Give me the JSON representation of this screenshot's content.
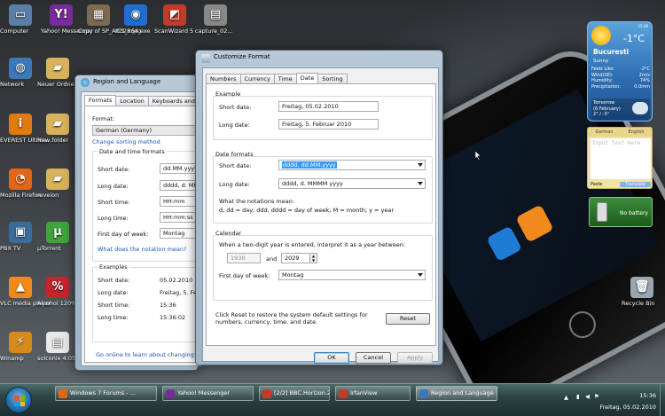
{
  "desktop": {
    "icons": [
      {
        "label": "Computer",
        "color": "#5a7ea6",
        "glyph": "▭"
      },
      {
        "label": "Yahoo! Messenger",
        "color": "#7a2aa0",
        "glyph": "Y!"
      },
      {
        "label": "Copy of SP_A0028.jpg",
        "color": "#7c6a52",
        "glyph": "▦"
      },
      {
        "label": "ICS_x64.exe",
        "color": "#1e6fd0",
        "glyph": "◉"
      },
      {
        "label": "ScanWizard 5",
        "color": "#c43a2a",
        "glyph": "◩"
      },
      {
        "label": "capture_02...",
        "color": "#888888",
        "glyph": "▤"
      },
      {
        "label": "Network",
        "color": "#3c78b8",
        "glyph": "◍"
      },
      {
        "label": "Neuer Ordner",
        "color": "#d9b35b",
        "glyph": "▰"
      },
      {
        "label": "EVEREST Ultima...",
        "color": "#e07b12",
        "glyph": "i"
      },
      {
        "label": "New folder",
        "color": "#d9b35b",
        "glyph": "▰"
      },
      {
        "label": "Mozilla Firefox",
        "color": "#e0661b",
        "glyph": "◔"
      },
      {
        "label": "reveion",
        "color": "#d9b35b",
        "glyph": "▰"
      },
      {
        "label": "PBX TV",
        "color": "#3a6c9a",
        "glyph": "▣"
      },
      {
        "label": "µTorrent",
        "color": "#3fa43a",
        "glyph": "µ"
      },
      {
        "label": "VLC media player",
        "color": "#f08a1c",
        "glyph": "▲"
      },
      {
        "label": "Alcohol 120%",
        "color": "#c3262a",
        "glyph": "%"
      },
      {
        "label": "Winamp",
        "color": "#d68a1a",
        "glyph": "⚡"
      },
      {
        "label": "solconix 4:05 12-01",
        "color": "#e8e8e8",
        "glyph": "▤"
      }
    ],
    "recycle_bin": "Recycle Bin"
  },
  "gadgets": {
    "weather": {
      "time": "15:36",
      "temperature": "-1°C",
      "city": "Bucuresti",
      "condition": "Sunny",
      "details": [
        {
          "k": "Feels Like:",
          "v": "-2°C"
        },
        {
          "k": "Wind(SE):",
          "v": "2m/s"
        },
        {
          "k": "Humidity:",
          "v": "74%"
        },
        {
          "k": "Precipitation:",
          "v": "0.0mm"
        }
      ],
      "tomorrow_label": "Tomorrow",
      "tomorrow_date": "(6 February)",
      "tomorrow_temps": "2° / -3°"
    },
    "translate": {
      "from": "German",
      "to": "English",
      "placeholder": "Input Text Here",
      "paste": "Paste",
      "button": "Translate"
    },
    "battery": {
      "status": "No battery"
    }
  },
  "region_window": {
    "title": "Region and Language",
    "tabs": [
      "Formats",
      "Location",
      "Keyboards and Langua"
    ],
    "format_label": "Format:",
    "format_value": "German (Germany)",
    "change_sorting": "Change sorting method",
    "date_time_header": "Date and time formats",
    "rows": [
      {
        "label": "Short date:",
        "value": "dd.MM.yyyy"
      },
      {
        "label": "Long date:",
        "value": "dddd, d. MMM"
      },
      {
        "label": "Short time:",
        "value": "HH:mm"
      },
      {
        "label": "Long time:",
        "value": "HH:mm:ss"
      },
      {
        "label": "First day of week:",
        "value": "Montag"
      }
    ],
    "notation_link": "What does the notation mean?",
    "examples_header": "Examples",
    "examples": [
      {
        "label": "Short date:",
        "value": "05.02.2010"
      },
      {
        "label": "Long date:",
        "value": "Freitag, 5. Febr"
      },
      {
        "label": "Short time:",
        "value": "15:36"
      },
      {
        "label": "Long time:",
        "value": "15:36:02"
      }
    ],
    "online_link": "Go online to learn about changing lan"
  },
  "customize_format": {
    "title": "Customize Format",
    "tabs": [
      "Numbers",
      "Currency",
      "Time",
      "Date",
      "Sorting"
    ],
    "active_tab": "Date",
    "example_header": "Example",
    "example_short_label": "Short date:",
    "example_short_value": "Freitag, 05.02.2010",
    "example_long_label": "Long date:",
    "example_long_value": "Freitag, 5. Februar 2010",
    "formats_header": "Date formats",
    "short_label": "Short date:",
    "short_value": "dddd, dd.MM.yyyy",
    "long_label": "Long date:",
    "long_value": "dddd, d. MMMM yyyy",
    "notation_title": "What the notations mean:",
    "notation_text": "d, dd = day;  ddd, dddd = day of week;  M = month;  y = year",
    "calendar_header": "Calendar",
    "calendar_text": "When a two-digit year is entered, interpret it as a year between:",
    "year_from": "1930",
    "and_label": "and",
    "year_to": "2029",
    "first_day_label": "First day of week:",
    "first_day_value": "Montag",
    "reset_text": "Click Reset to restore the system default settings for numbers, currency, time, and date.",
    "reset_button": "Reset",
    "ok": "OK",
    "cancel": "Cancel",
    "apply": "Apply"
  },
  "taskbar": {
    "buttons": [
      {
        "label": "Windows 7 Forums - ...",
        "color": "#e0661b"
      },
      {
        "label": "Yahoo! Messenger",
        "color": "#7a2aa0"
      },
      {
        "label": "[2/2] BBC.Horizon.20...",
        "color": "#c43a2a"
      },
      {
        "label": "IrfanView",
        "color": "#c43a2a"
      },
      {
        "label": "Region and Language",
        "color": "#3c78b8"
      }
    ],
    "clock_time": "15:36",
    "clock_date": "Freitag, 05.02.2010"
  }
}
